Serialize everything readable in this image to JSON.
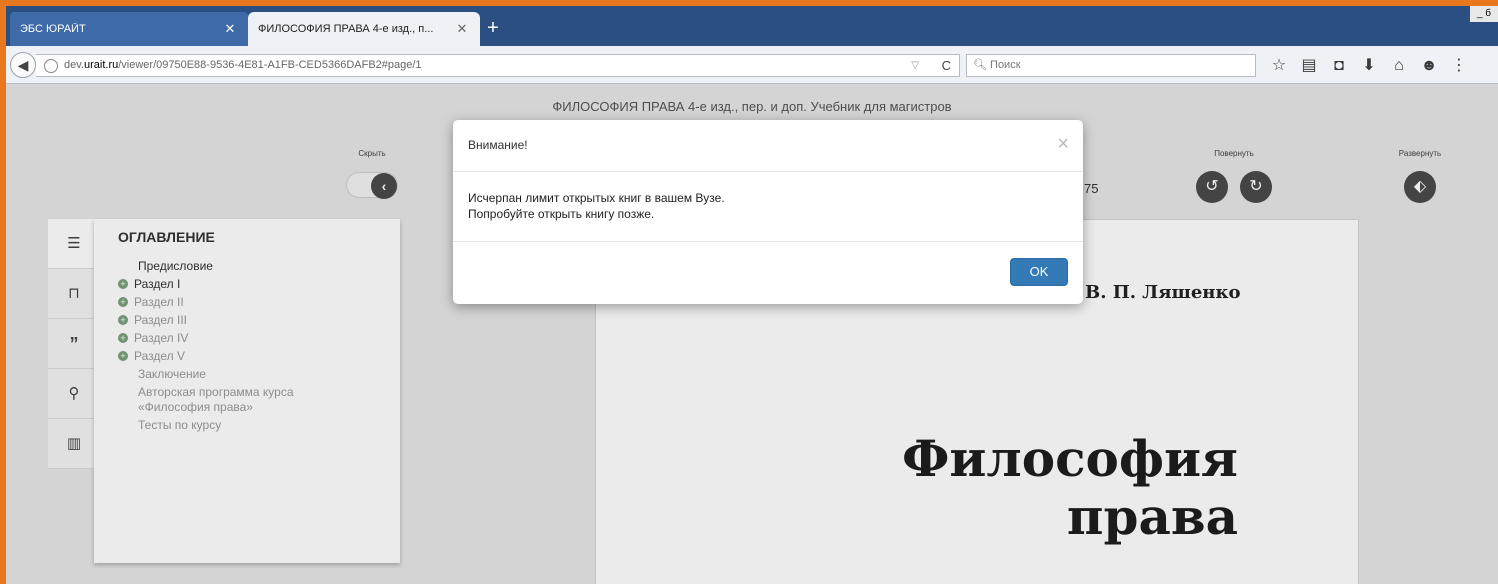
{
  "browser": {
    "tabs": [
      {
        "title": "ЭБС ЮРАЙТ",
        "close": "✕"
      },
      {
        "title": "ФИЛОСОФИЯ ПРАВА 4-е изд., п...",
        "close": "✕"
      }
    ],
    "new_tab": "+",
    "window_controls": "_ б",
    "back_icon": "back-arrow-icon",
    "url_prefix": "dev.",
    "url_host": "urait.ru",
    "url_path": "/viewer/09750E88-9536-4E81-A1FB-CED5366DAFB2#page/1",
    "search_placeholder": "Поиск",
    "toolbar_icons": [
      "star-icon",
      "reading-list-icon",
      "pocket-icon",
      "download-icon",
      "home-icon",
      "chat-icon",
      "menu-icon"
    ]
  },
  "viewer": {
    "book_title": "ФИЛОСОФИЯ ПРАВА 4-е изд., пер. и доп. Учебник для магистров",
    "hide_label": "Скрыть",
    "rotate_label": "Повернуть",
    "expand_label": "Развернуть",
    "page_count_fragment": "75",
    "toc": {
      "heading": "ОГЛАВЛЕНИЕ",
      "items": [
        {
          "label": "Предисловие"
        },
        {
          "label": "Раздел I"
        },
        {
          "label": "Раздел II"
        },
        {
          "label": "Раздел III"
        },
        {
          "label": "Раздел IV"
        },
        {
          "label": "Раздел V"
        },
        {
          "label": "Заключение"
        },
        {
          "label": "Авторская программа курса «Философия права»"
        },
        {
          "label": "Тесты по курсу"
        }
      ]
    },
    "page": {
      "author": "В. П. Ляшенко",
      "title_line1": "Философия",
      "title_line2": "права"
    }
  },
  "modal": {
    "title": "Внимание!",
    "close": "×",
    "line1": "Исчерпан лимит открытых книг в вашем Вузе.",
    "line2": "Попробуйте открыть книгу позже.",
    "ok": "OK"
  }
}
